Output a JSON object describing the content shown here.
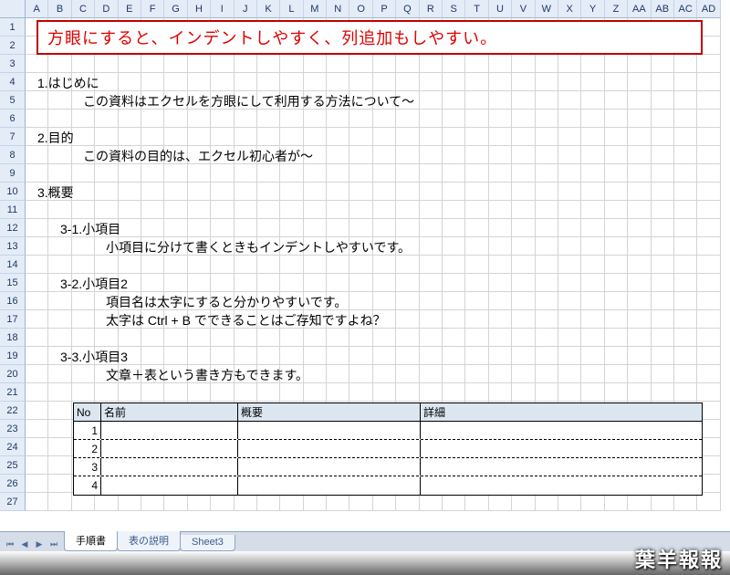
{
  "columns": [
    "A",
    "B",
    "C",
    "D",
    "E",
    "F",
    "G",
    "H",
    "I",
    "J",
    "K",
    "L",
    "M",
    "N",
    "O",
    "P",
    "Q",
    "R",
    "S",
    "T",
    "U",
    "V",
    "W",
    "X",
    "Y",
    "Z",
    "AA",
    "AB",
    "AC",
    "AD"
  ],
  "rows": 27,
  "banner": "方眼にすると、インデントしやすく、列追加もしやすい。",
  "content": {
    "r4": "1.はじめに",
    "r5": "この資料はエクセルを方眼にして利用する方法について～",
    "r7": "2.目的",
    "r8": "この資料の目的は、エクセル初心者が～",
    "r10": "3.概要",
    "r12": "3-1.小項目",
    "r13": "小項目に分けて書くときもインデントしやすいです。",
    "r15": "3-2.小項目2",
    "r16": "項目名は太字にすると分かりやすいです。",
    "r17": "太字は Ctrl + B でできることはご存知ですよね？",
    "r19": "3-3.小項目3",
    "r20": "文章＋表という書き方もできます。"
  },
  "table": {
    "headers": {
      "no": "No",
      "name": "名前",
      "overview": "概要",
      "detail": "詳細"
    },
    "rows": [
      {
        "no": "1"
      },
      {
        "no": "2"
      },
      {
        "no": "3"
      },
      {
        "no": "4"
      }
    ]
  },
  "tabs": {
    "active": "手順書",
    "t2": "表の説明",
    "t3": "Sheet3"
  },
  "watermark": "葉羊報報"
}
